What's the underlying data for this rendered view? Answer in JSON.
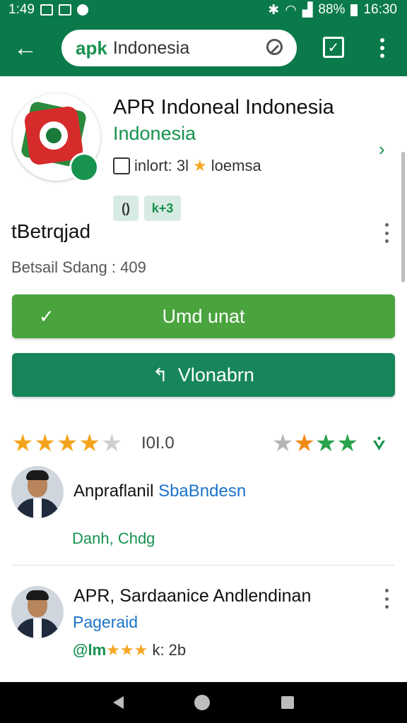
{
  "status_bar": {
    "time_left": "1:49",
    "battery": "88%",
    "clock": "16:30"
  },
  "app_bar": {
    "search_logo": "apk",
    "search_query": "Indonesia"
  },
  "app": {
    "title": "APR Indoneal Indonesia",
    "developer": "Indonesia",
    "meta_text": "inlort: 3l",
    "meta_label": "loemsa",
    "chip_1": "()",
    "chip_2": "k+3"
  },
  "details": {
    "section_title": "tBetrqjad",
    "subtitle": "Betsail Sdang : 409"
  },
  "buttons": {
    "update_label": "Umd unat",
    "open_label": "Vlonabrn"
  },
  "ratings": {
    "left_stars": 4,
    "left_stars_max": 5,
    "value_text": "I0I.0",
    "right_stars": [
      "gray",
      "orange",
      "green",
      "green"
    ]
  },
  "reviews": [
    {
      "name": "Anpraflanil",
      "name_link": "SbaBndesn",
      "sub": "Danh, Chdg"
    },
    {
      "name": "APR, Sardaanice Andlendinan",
      "tag": "Pageraid",
      "meta_prefix": "@lm",
      "meta_stars": "★★★",
      "meta_suffix": "k: 2b"
    }
  ]
}
